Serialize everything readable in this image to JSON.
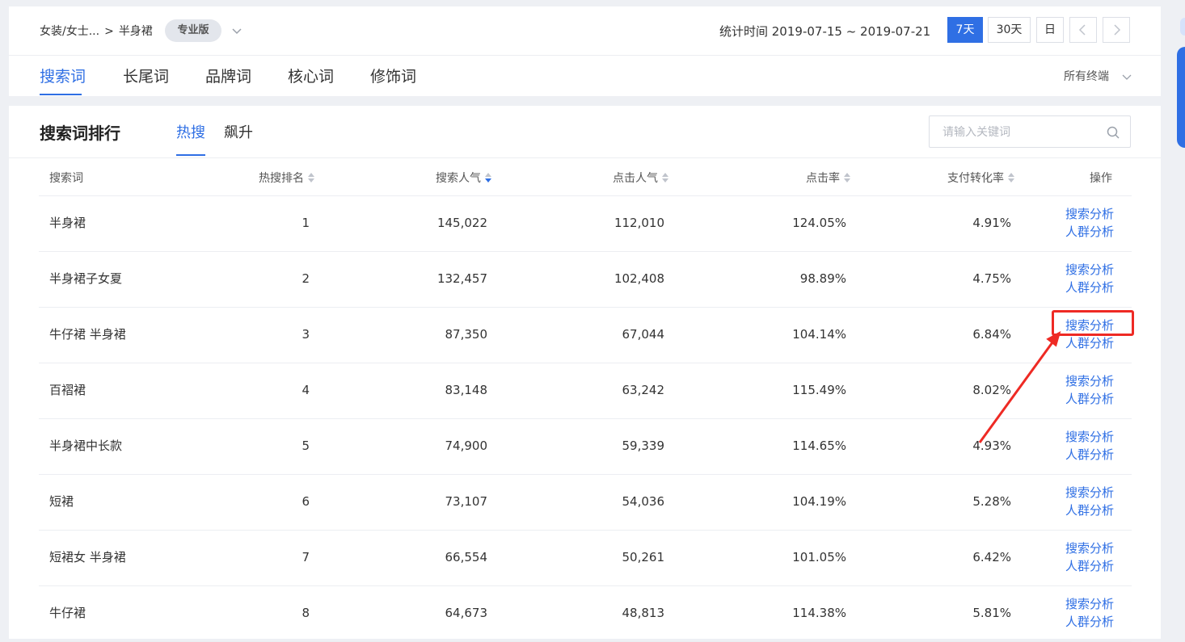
{
  "breadcrumb": {
    "category": "女装/女士...",
    "separator": ">",
    "subcategory": "半身裙",
    "edition_badge": "专业版"
  },
  "stat": {
    "label": "统计时间 2019-07-15 ~ 2019-07-21"
  },
  "periods": [
    {
      "label": "7天",
      "active": true
    },
    {
      "label": "30天",
      "active": false
    },
    {
      "label": "日",
      "active": false
    }
  ],
  "main_tabs": [
    {
      "label": "搜索词",
      "active": true
    },
    {
      "label": "长尾词",
      "active": false
    },
    {
      "label": "品牌词",
      "active": false
    },
    {
      "label": "核心词",
      "active": false
    },
    {
      "label": "修饰词",
      "active": false
    }
  ],
  "terminal": "所有终端",
  "section": {
    "title": "搜索词排行",
    "sub_tabs": [
      {
        "label": "热搜",
        "active": true
      },
      {
        "label": "飙升",
        "active": false
      }
    ],
    "search_placeholder": "请输入关键词"
  },
  "table": {
    "headers": {
      "keyword": "搜索词",
      "rank": "热搜排名",
      "search_pop": "搜索人气",
      "click_pop": "点击人气",
      "ctr": "点击率",
      "pay_rate": "支付转化率",
      "action": "操作"
    },
    "action_links": {
      "search": "搜索分析",
      "crowd": "人群分析"
    },
    "rows": [
      {
        "keyword": "半身裙",
        "rank": "1",
        "search_pop": "145,022",
        "click_pop": "112,010",
        "ctr": "124.05%",
        "pay_rate": "4.91%"
      },
      {
        "keyword": "半身裙子女夏",
        "rank": "2",
        "search_pop": "132,457",
        "click_pop": "102,408",
        "ctr": "98.89%",
        "pay_rate": "4.75%"
      },
      {
        "keyword": "牛仔裙 半身裙",
        "rank": "3",
        "search_pop": "87,350",
        "click_pop": "67,044",
        "ctr": "104.14%",
        "pay_rate": "6.84%"
      },
      {
        "keyword": "百褶裙",
        "rank": "4",
        "search_pop": "83,148",
        "click_pop": "63,242",
        "ctr": "115.49%",
        "pay_rate": "8.02%"
      },
      {
        "keyword": "半身裙中长款",
        "rank": "5",
        "search_pop": "74,900",
        "click_pop": "59,339",
        "ctr": "114.65%",
        "pay_rate": "4.93%"
      },
      {
        "keyword": "短裙",
        "rank": "6",
        "search_pop": "73,107",
        "click_pop": "54,036",
        "ctr": "104.19%",
        "pay_rate": "5.28%"
      },
      {
        "keyword": "短裙女 半身裙",
        "rank": "7",
        "search_pop": "66,554",
        "click_pop": "50,261",
        "ctr": "101.05%",
        "pay_rate": "6.42%"
      },
      {
        "keyword": "牛仔裙",
        "rank": "8",
        "search_pop": "64,673",
        "click_pop": "48,813",
        "ctr": "114.38%",
        "pay_rate": "5.81%"
      }
    ]
  },
  "colors": {
    "accent": "#2f6fe4",
    "annotation": "#ee2a24"
  },
  "icons": {
    "badge_dropdown": "chevron-down-icon",
    "prev": "chevron-left-icon",
    "next": "chevron-right-icon",
    "search": "search-icon",
    "sort": "sort-icon"
  }
}
